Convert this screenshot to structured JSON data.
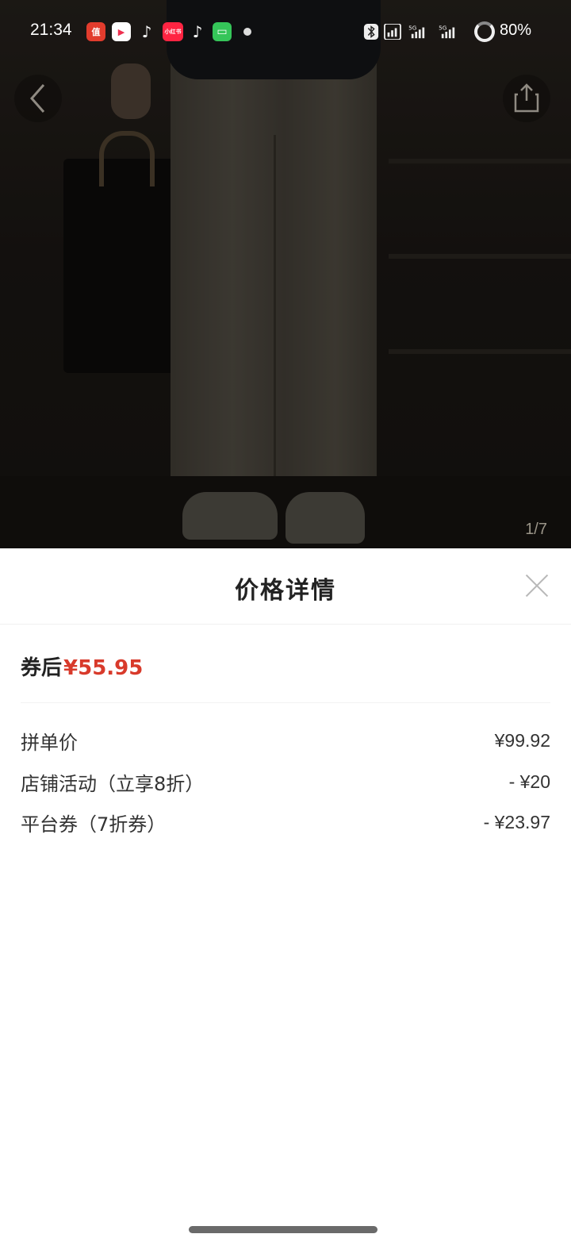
{
  "status_bar": {
    "time": "21:34",
    "apps": [
      {
        "icon": "zhide-app-icon",
        "label": "值",
        "color": "#e23c2d"
      },
      {
        "icon": "video-app-icon",
        "label": "▶",
        "color": "#ee2f4f"
      },
      {
        "icon": "tiktok-icon",
        "label": "♪",
        "color": "#000000"
      },
      {
        "icon": "xiaohongshu-icon",
        "label": "小红书",
        "color": "#ff2442"
      },
      {
        "icon": "tiktok-lite-icon",
        "label": "♪",
        "color": "#000000"
      },
      {
        "icon": "message-app-icon",
        "label": "▭",
        "color": "#35c559"
      }
    ],
    "battery": "80%"
  },
  "gallery": {
    "counter": "1/7"
  },
  "sheet": {
    "title": "价格详情",
    "final_label": "券后",
    "final_price": "¥55.95",
    "lines": [
      {
        "label": "拼单价",
        "value": "¥99.92"
      },
      {
        "label": "店铺活动（立享8折）",
        "value": "- ¥20"
      },
      {
        "label": "平台券（7折券）",
        "value": "- ¥23.97"
      }
    ]
  },
  "colors": {
    "accent": "#d83a2b"
  }
}
